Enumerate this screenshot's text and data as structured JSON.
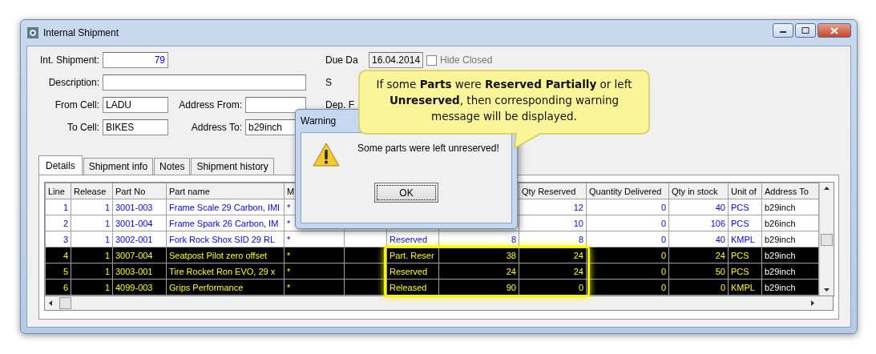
{
  "window": {
    "title": "Internal Shipment"
  },
  "form": {
    "int_shipment": {
      "label": "Int. Shipment:",
      "value": "79"
    },
    "description": {
      "label": "Description:"
    },
    "from_cell": {
      "label": "From Cell:",
      "value": "LADU"
    },
    "address_from": {
      "label": "Address From:"
    },
    "to_cell": {
      "label": "To Cell:",
      "value": "BIKES"
    },
    "address_to": {
      "label": "Address To:",
      "value": "b29inch"
    },
    "due_date": {
      "label": "Due Da",
      "value": "16.04.2014"
    },
    "hide_closed": {
      "label": "Hide Closed",
      "checked": false
    },
    "state": {
      "label": "S"
    },
    "dep": {
      "label": "Dep. F"
    }
  },
  "tabs": [
    {
      "label": "Details",
      "selected": true
    },
    {
      "label": "Shipment info",
      "selected": false
    },
    {
      "label": "Notes",
      "selected": false
    },
    {
      "label": "Shipment history",
      "selected": false
    }
  ],
  "table": {
    "columns": [
      "Line",
      "Release",
      "Part No",
      "Part name",
      "M",
      null,
      null,
      null,
      "Qty Reserved",
      "Quantity Delivered",
      "Qty in stock",
      "Unit of",
      "Address To"
    ],
    "rows": [
      {
        "selected": false,
        "cells": [
          "1",
          "1",
          "3001-003",
          "Frame Scale 29 Carbon, IMI",
          "*",
          null,
          null,
          null,
          "12",
          "0",
          "40",
          "PCS",
          "b29inch"
        ]
      },
      {
        "selected": false,
        "cells": [
          "2",
          "1",
          "3001-004",
          "Frame Spark 26 Carbon, IM",
          "*",
          null,
          null,
          null,
          "10",
          "0",
          "106",
          "PCS",
          "b26inch"
        ]
      },
      {
        "selected": false,
        "cells": [
          "3",
          "1",
          "3002-001",
          "Fork Rock Shox SID 29 RL",
          "*",
          null,
          "Reserved",
          "8",
          "8",
          "0",
          "40",
          "KMPL",
          "b29inch"
        ]
      },
      {
        "selected": true,
        "cells": [
          "4",
          "1",
          "3007-004",
          "Seatpost Pilot zero offset",
          "*",
          null,
          "Part. Reser",
          "38",
          "24",
          "0",
          "24",
          "PCS",
          "b29inch"
        ]
      },
      {
        "selected": true,
        "cells": [
          "5",
          "1",
          "3003-001",
          "Tire Rocket Ron EVO, 29 x",
          "*",
          null,
          "Reserved",
          "24",
          "24",
          "0",
          "50",
          "PCS",
          "b29inch"
        ]
      },
      {
        "selected": true,
        "cells": [
          "6",
          "1",
          "4099-003",
          "Grips Performance",
          "*",
          null,
          "Released",
          "90",
          "0",
          "0",
          "0",
          "KMPL",
          "b29inch"
        ]
      }
    ]
  },
  "dialog": {
    "title": "Warning",
    "message": "Some parts were left unreserved!",
    "button": "OK"
  },
  "callout": {
    "text": "If some **Parts** were **Reserved Partially** or left **Unreserved**, then corresponding warning message will be displayed."
  }
}
